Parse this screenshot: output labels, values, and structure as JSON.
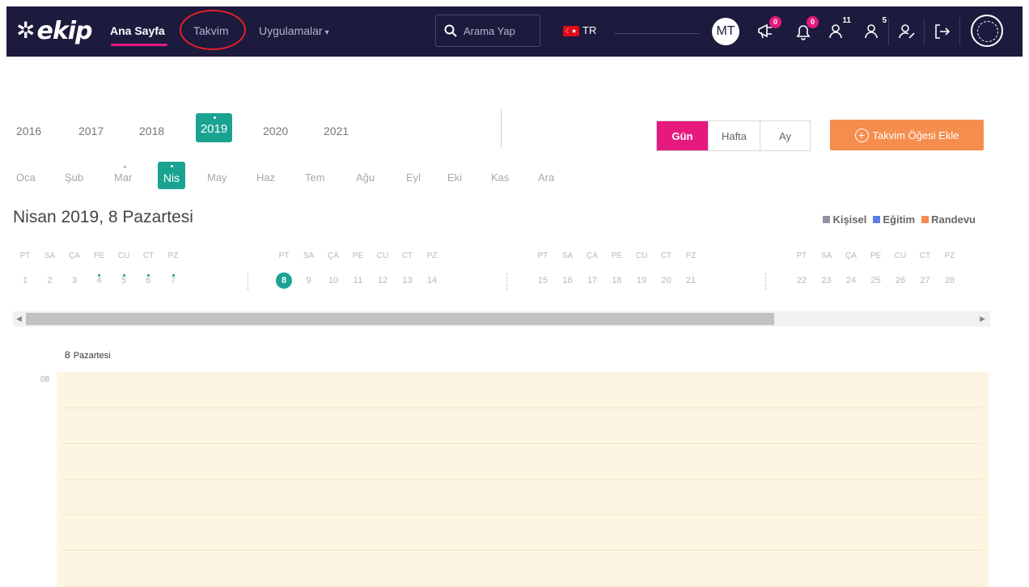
{
  "nav": {
    "logo": "ekip",
    "home": "Ana Sayfa",
    "calendar": "Takvim",
    "apps": "Uygulamalar",
    "search_placeholder": "Arama Yap",
    "language": "TR",
    "avatar_initials": "MT",
    "announcements_badge": "0",
    "notifications_badge": "0",
    "users_count_1": "11",
    "users_count_2": "5"
  },
  "years": [
    "2016",
    "2017",
    "2018",
    "2019",
    "2020",
    "2021"
  ],
  "active_year": "2019",
  "months": [
    "Oca",
    "Şub",
    "Mar",
    "Nis",
    "May",
    "Haz",
    "Tem",
    "Ağu",
    "Eyl",
    "Eki",
    "Kas",
    "Ara"
  ],
  "active_month": "Nis",
  "views": {
    "day": "Gün",
    "week": "Hafta",
    "month": "Ay"
  },
  "add_button": "Takvim Öğesi Ekle",
  "date_title": "Nisan 2019, 8 Pazartesi",
  "legend": [
    {
      "label": "Kişisel",
      "color": "#8f92a3"
    },
    {
      "label": "Eğitim",
      "color": "#5b7fe8"
    },
    {
      "label": "Randevu",
      "color": "#f58d4e"
    }
  ],
  "weekday_labels": [
    "PT",
    "SA",
    "ÇA",
    "PE",
    "CU",
    "CT",
    "PZ"
  ],
  "days": [
    "1",
    "2",
    "3",
    "4",
    "5",
    "6",
    "7",
    "8",
    "9",
    "10",
    "11",
    "12",
    "13",
    "14",
    "15",
    "16",
    "17",
    "18",
    "19",
    "20",
    "21",
    "22",
    "23",
    "24",
    "25",
    "26",
    "27",
    "28"
  ],
  "selected_day": "8",
  "dotted_days": [
    "4",
    "5",
    "6",
    "7"
  ],
  "day_view": {
    "day_number": "8",
    "day_name": "Pazartesi",
    "first_hour": "08"
  },
  "colors": {
    "nav_bg": "#1c1a3d",
    "accent_pink": "#e6197e",
    "accent_teal": "#1ba392",
    "accent_orange": "#f58d4e",
    "day_bg": "#fdf5e1"
  }
}
